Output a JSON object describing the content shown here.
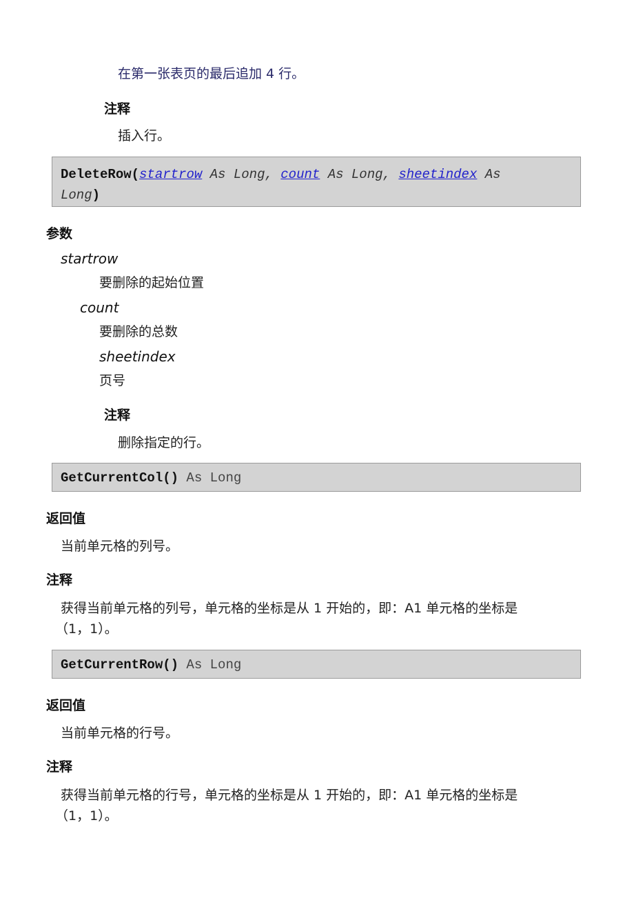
{
  "intro": {
    "example_text": "在第一张表页的最后追加 4 行。",
    "notes_heading": "注释",
    "notes_text": "插入行。"
  },
  "delete_row": {
    "signature": {
      "name": "DeleteRow(",
      "params": [
        {
          "name": "startrow",
          "type": " As Long, "
        },
        {
          "name": "count",
          "type": " As Long, "
        },
        {
          "name": "sheetindex",
          "type": " As"
        }
      ],
      "wrap_type": "Long",
      "close": ")"
    },
    "params_heading": "参数",
    "params": [
      {
        "name": "startrow",
        "desc": "要删除的起始位置"
      },
      {
        "name": "count",
        "desc": "要删除的总数"
      },
      {
        "name": "sheetindex",
        "desc": "页号"
      }
    ],
    "notes_heading": "注释",
    "notes_text": "删除指定的行。"
  },
  "get_current_col": {
    "signature": {
      "name": "GetCurrentCol()",
      "returns": " As Long"
    },
    "return_heading": "返回值",
    "return_text": "当前单元格的列号。",
    "notes_heading": "注释",
    "notes_line1": "获得当前单元格的列号，单元格的坐标是从 1 开始的，即：A1 单元格的坐标是",
    "notes_line2": "（1，1）。"
  },
  "get_current_row": {
    "signature": {
      "name": "GetCurrentRow()",
      "returns": " As Long"
    },
    "return_heading": "返回值",
    "return_text": "当前单元格的行号。",
    "notes_heading": "注释",
    "notes_line1": "获得当前单元格的行号，单元格的坐标是从 1 开始的，即：A1 单元格的坐标是",
    "notes_line2": "（1，1）。"
  }
}
